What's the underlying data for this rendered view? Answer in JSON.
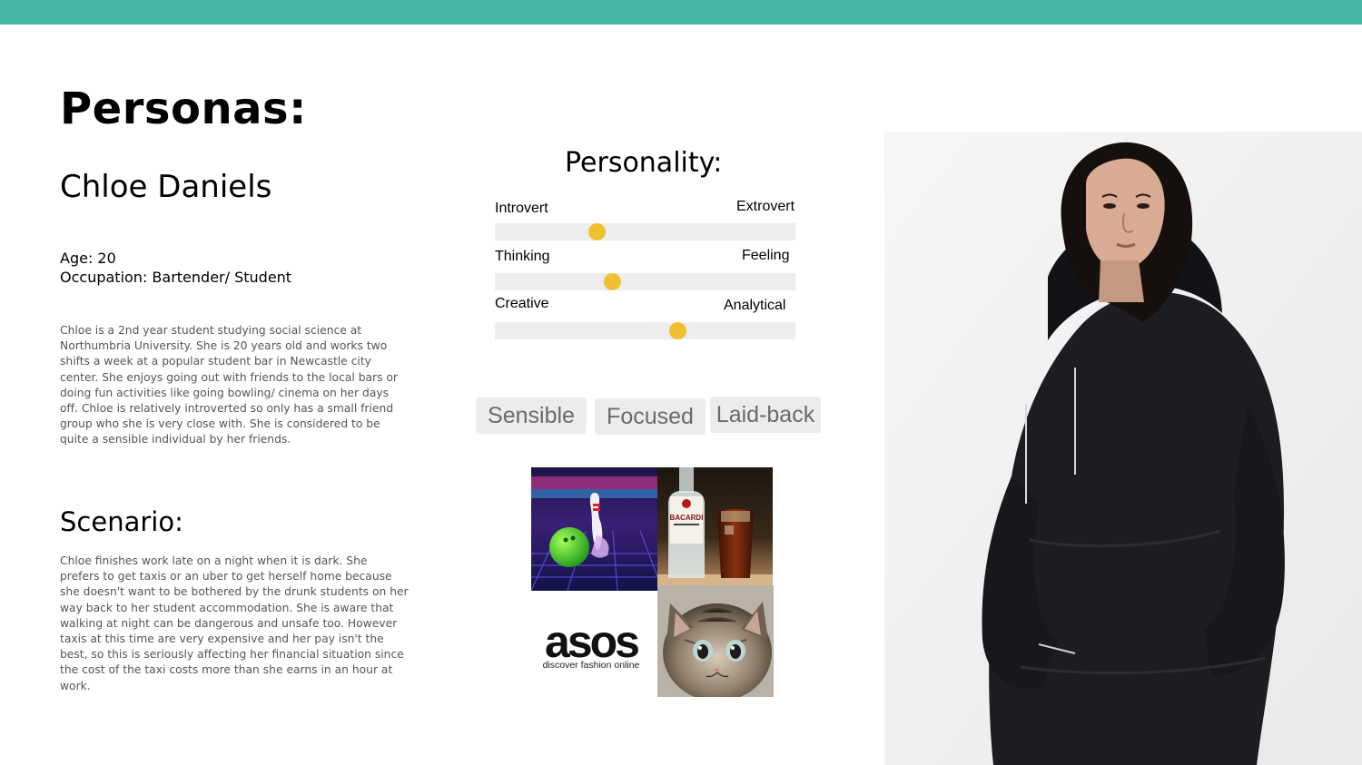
{
  "title": "Personas:",
  "persona": {
    "name": "Chloe Daniels",
    "age": "Age: 20",
    "occupation": "Occupation: Bartender/ Student",
    "bio": "Chloe is a 2nd year student studying social science at Northumbria University. She is 20 years old and works two shifts a week at a popular student bar in Newcastle city center. She enjoys going out with friends to the local bars or doing fun activities like going bowling/ cinema on her days off. Chloe is relatively introverted so only has a small friend group who she is very close with. She is considered to be quite a sensible individual by her friends."
  },
  "scenario": {
    "heading": "Scenario:",
    "text": "Chloe finishes work late on a night when it is dark. She prefers to get taxis or an uber to get herself home because she doesn't want to be bothered by the drunk students on her way back to her student accommodation. She is aware that walking at night can be dangerous and unsafe too. However taxis at this time are very expensive and her pay isn't the best, so this is seriously affecting her financial situation since the cost of the taxi costs more than she earns in an hour at work."
  },
  "personality": {
    "heading": "Personality:",
    "traits": [
      {
        "left": "Introvert",
        "right": "Extrovert",
        "value": 0.34
      },
      {
        "left": "Thinking",
        "right": "Feeling",
        "value": 0.39
      },
      {
        "left": "Creative",
        "right": "Analytical",
        "value": 0.61
      }
    ],
    "tags": [
      "Sensible",
      "Focused",
      "Laid-back"
    ]
  },
  "moodboard": {
    "logo_word": "asos",
    "logo_tagline": "discover fashion online",
    "bottle_label": "BACARDI"
  },
  "colors": {
    "accent_bar": "#47b8a6",
    "slider_dot": "#f0c02f",
    "slider_track": "#ededed"
  }
}
